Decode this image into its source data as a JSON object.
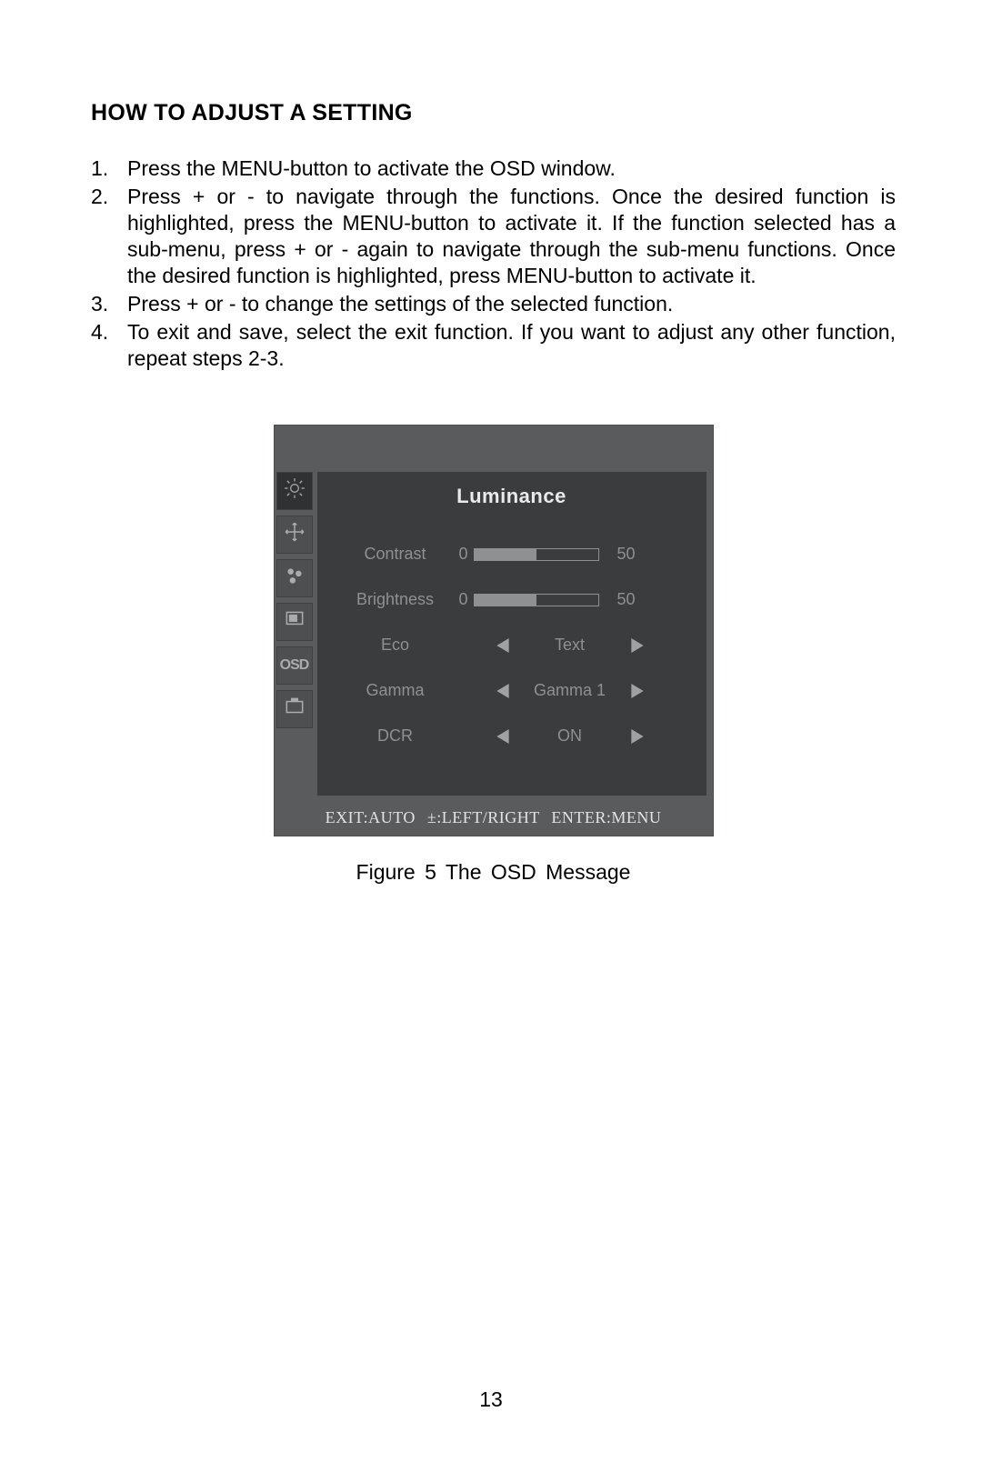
{
  "heading": "HOW TO ADJUST A SETTING",
  "steps": [
    "Press the MENU-button to activate the OSD window.",
    "Press + or - to navigate through the functions. Once the desired function is highlighted, press the MENU-button to activate it. If the function selected has a sub-menu, press + or - again to navigate through the sub-menu functions. Once the desired function is highlighted, press MENU-button to activate it.",
    "Press + or - to change the settings of the selected function.",
    "To exit and save, select the exit function. If you want to adjust any other function, repeat steps 2-3."
  ],
  "osd": {
    "panel_title": "Luminance",
    "settings": {
      "contrast": {
        "label": "Contrast",
        "min": "0",
        "value": "50"
      },
      "brightness": {
        "label": "Brightness",
        "min": "0",
        "value": "50"
      },
      "eco": {
        "label": "Eco",
        "value": "Text"
      },
      "gamma": {
        "label": "Gamma",
        "value": "Gamma 1"
      },
      "dcr": {
        "label": "DCR",
        "value": "ON"
      }
    },
    "footer": "EXIT:AUTO  ±:LEFT/RIGHT  ENTER:MENU",
    "tab_osd_label": "OSD"
  },
  "figure_caption": "Figure 5   The  OSD  Message",
  "page_number": "13"
}
